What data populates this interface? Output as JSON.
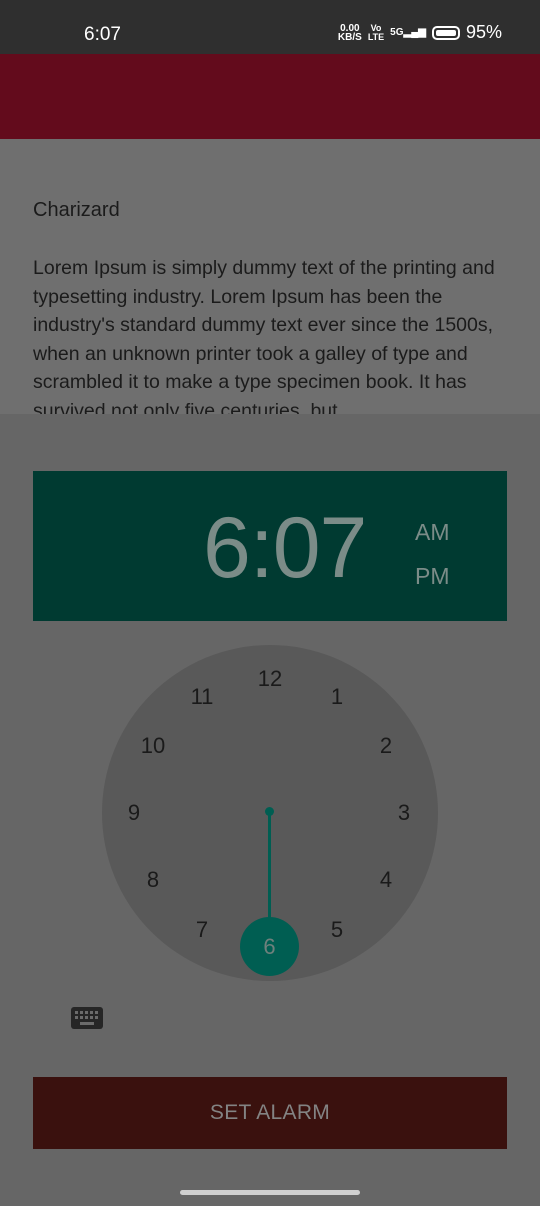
{
  "status_bar": {
    "time": "6:07",
    "net_speed_value": "0.00",
    "net_speed_unit": "KB/S",
    "volte_top": "Vo",
    "volte_bottom": "LTE",
    "network": "5G",
    "battery": "95%"
  },
  "content": {
    "title": "Charizard",
    "body": "Lorem Ipsum is simply dummy text of the printing and typesetting industry. Lorem Ipsum has been the industry's standard dummy text ever since the 1500s, when an unknown printer took a galley of type and scrambled it to make a type specimen book. It has survived not only five centuries, but"
  },
  "time_picker": {
    "time": "6:07",
    "am": "AM",
    "pm": "PM",
    "selected_hour": "6",
    "numbers": [
      "12",
      "1",
      "2",
      "3",
      "4",
      "5",
      "7",
      "8",
      "9",
      "10",
      "11"
    ]
  },
  "set_alarm_label": "SET ALARM",
  "colors": {
    "app_bar": "#630b1c",
    "header": "#003a31",
    "accent": "#005e52",
    "button": "#3a110e"
  }
}
